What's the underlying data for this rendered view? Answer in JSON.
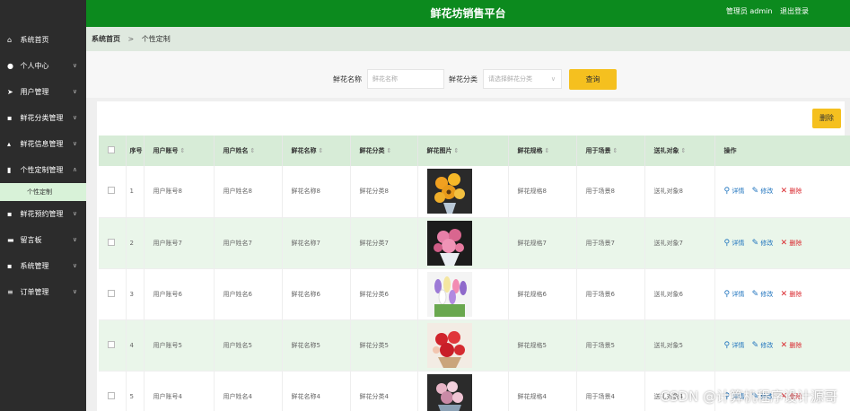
{
  "header": {
    "title": "鲜花坊销售平台",
    "user_label": "管理员 admin",
    "logout_label": "退出登录"
  },
  "sidebar": {
    "items": [
      {
        "icon": "home-icon",
        "label": "系统首页",
        "chevron": ""
      },
      {
        "icon": "user-icon",
        "label": "个人中心",
        "chevron": "∨"
      },
      {
        "icon": "send-icon",
        "label": "用户管理",
        "chevron": "∨"
      },
      {
        "icon": "grid-icon",
        "label": "鲜花分类管理",
        "chevron": "∨"
      },
      {
        "icon": "thumb-icon",
        "label": "鲜花信息管理",
        "chevron": "∨"
      },
      {
        "icon": "doc-icon",
        "label": "个性定制管理",
        "chevron": "∧"
      },
      {
        "icon": "grid-icon",
        "label": "鲜花预约管理",
        "chevron": "∨"
      },
      {
        "icon": "board-icon",
        "label": "留言板",
        "chevron": "∨"
      },
      {
        "icon": "grid-icon",
        "label": "系统管理",
        "chevron": "∨"
      },
      {
        "icon": "list-icon",
        "label": "订单管理",
        "chevron": "∨"
      }
    ],
    "submenu_label": "个性定制"
  },
  "breadcrumb": {
    "home": "系统首页",
    "separator": ">",
    "current": "个性定制"
  },
  "search": {
    "name_label": "鲜花名称",
    "name_placeholder": "鲜花名称",
    "category_label": "鲜花分类",
    "category_placeholder": "请选择鲜花分类",
    "button_label": "查询"
  },
  "toolbar": {
    "delete_label": "删除"
  },
  "table": {
    "headers": [
      "",
      "序号",
      "用户账号",
      "用户姓名",
      "鲜花名称",
      "鲜花分类",
      "鲜花图片",
      "鲜花规格",
      "用于场景",
      "送礼对象",
      "操作"
    ],
    "rows": [
      {
        "index": "1",
        "account": "用户账号8",
        "name": "用户姓名8",
        "flower": "鲜花名称8",
        "category": "鲜花分类8",
        "spec": "鲜花规格8",
        "scene": "用于场景8",
        "recipient": "送礼对象8"
      },
      {
        "index": "2",
        "account": "用户账号7",
        "name": "用户姓名7",
        "flower": "鲜花名称7",
        "category": "鲜花分类7",
        "spec": "鲜花规格7",
        "scene": "用于场景7",
        "recipient": "送礼对象7"
      },
      {
        "index": "3",
        "account": "用户账号6",
        "name": "用户姓名6",
        "flower": "鲜花名称6",
        "category": "鲜花分类6",
        "spec": "鲜花规格6",
        "scene": "用于场景6",
        "recipient": "送礼对象6"
      },
      {
        "index": "4",
        "account": "用户账号5",
        "name": "用户姓名5",
        "flower": "鲜花名称5",
        "category": "鲜花分类5",
        "spec": "鲜花规格5",
        "scene": "用于场景5",
        "recipient": "送礼对象5"
      },
      {
        "index": "5",
        "account": "用户账号4",
        "name": "用户姓名4",
        "flower": "鲜花名称4",
        "category": "鲜花分类4",
        "spec": "鲜花规格4",
        "scene": "用于场景4",
        "recipient": "送礼对象4"
      }
    ],
    "actions": {
      "detail": "详情",
      "edit": "修改",
      "delete": "删除"
    }
  },
  "watermark": "CSDN @计算机程序设计源哥",
  "colors": {
    "header_green": "#0c8a1e",
    "sidebar_dark": "#2c2c2c",
    "accent_yellow": "#f5c01f",
    "row_green": "#eaf6ea",
    "header_row": "#d7ecd7"
  }
}
